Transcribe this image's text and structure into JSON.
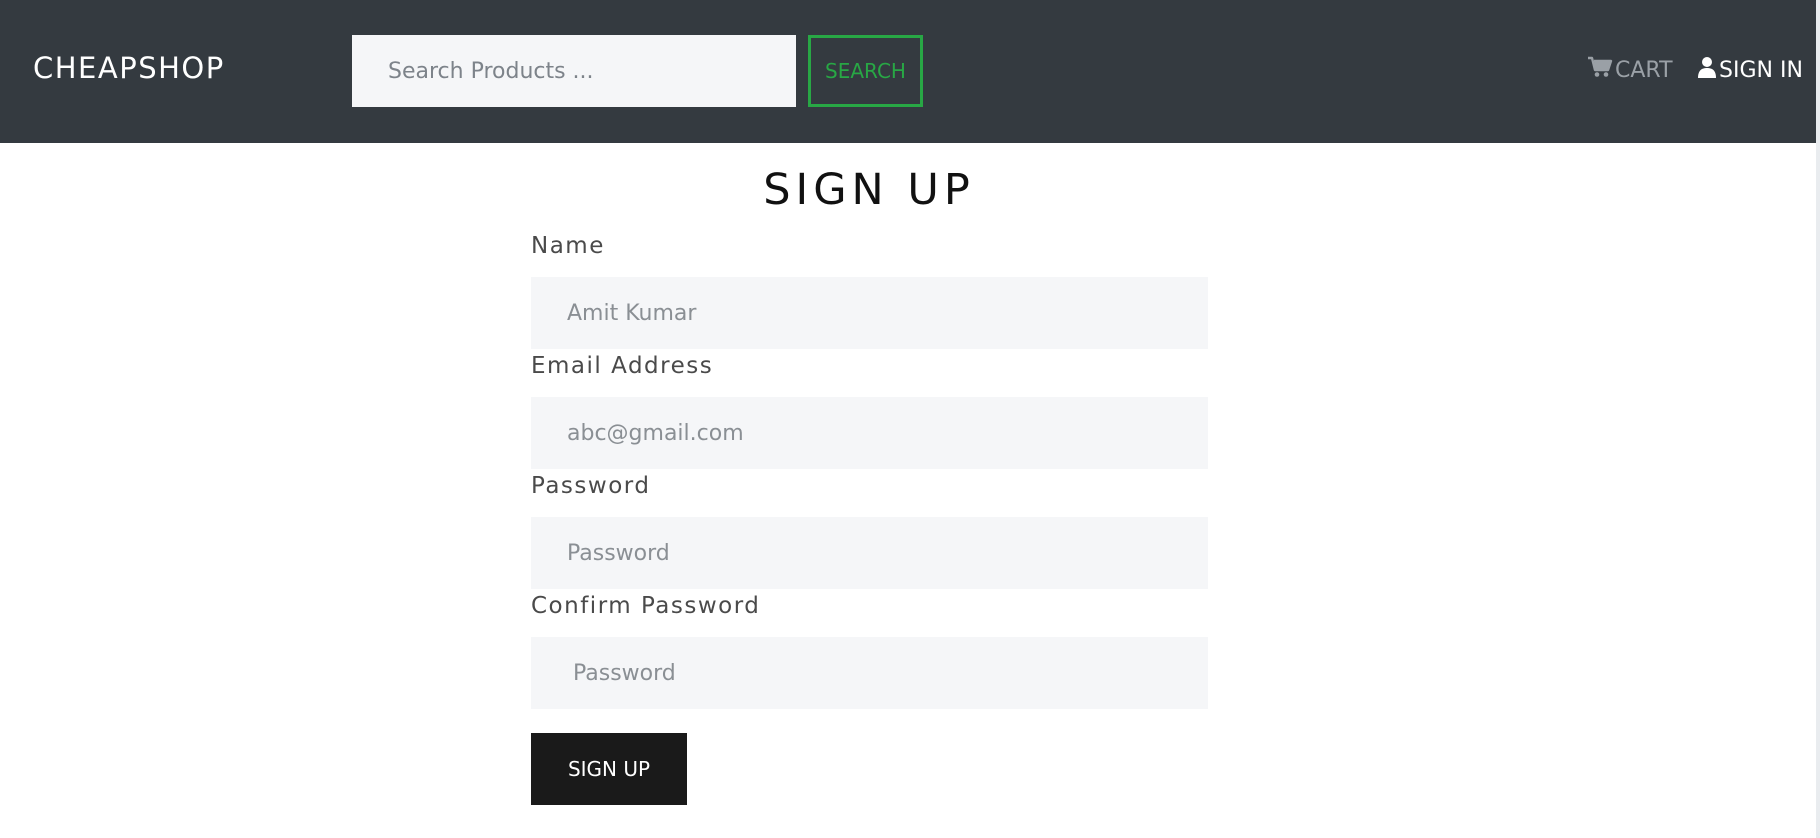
{
  "header": {
    "brand": "CHEAPSHOP",
    "search": {
      "placeholder": "Search Products ...",
      "value": ""
    },
    "search_button": "SEARCH",
    "cart_label": "CART",
    "signin_label": "SIGN IN",
    "cart_icon": "cart-icon",
    "user_icon": "user-icon"
  },
  "form": {
    "title": "SIGN UP",
    "fields": [
      {
        "label": "Name",
        "placeholder": "Amit Kumar",
        "value": ""
      },
      {
        "label": "Email Address",
        "placeholder": "abc@gmail.com",
        "value": ""
      },
      {
        "label": "Password",
        "placeholder": "Password",
        "value": ""
      },
      {
        "label": "Confirm Password",
        "placeholder": "Password",
        "value": ""
      }
    ],
    "submit_label": "SIGN UP"
  },
  "colors": {
    "navbar_bg": "#343a40",
    "accent_green": "#28a745",
    "button_dark": "#1a1a1a",
    "input_bg": "#f5f6f8"
  }
}
